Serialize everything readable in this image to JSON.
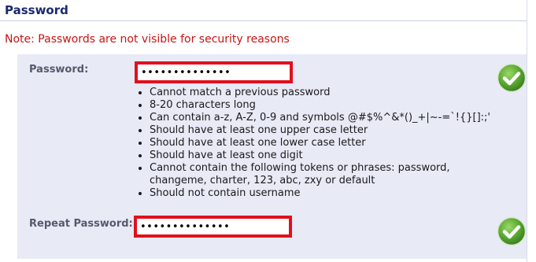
{
  "section": {
    "title": "Password"
  },
  "note": "Note: Passwords are not visible for security reasons",
  "password": {
    "label": "Password:",
    "value": "••••••••••••••",
    "valid_icon": "green-checkmark-icon"
  },
  "repeat": {
    "label": "Repeat Password:",
    "value": "••••••••••••••",
    "valid_icon": "green-checkmark-icon"
  },
  "requirements": [
    "Cannot match a previous password",
    "8-20 characters long",
    "Can contain a-z, A-Z, 0-9 and symbols @#$%^&*()_+|~-=`!{}[]:;'",
    "Should have at least one upper case letter",
    "Should have at least one lower case letter",
    "Should have at least one digit",
    "Cannot contain the following tokens or phrases: password, changeme, charter, 123, abc, zxy or default",
    "Should not contain username"
  ],
  "colors": {
    "title": "#1a2a6c",
    "note": "#c81414",
    "panel": "#e8eaf6",
    "input_border": "#e1101c",
    "check": "#5aa832"
  }
}
